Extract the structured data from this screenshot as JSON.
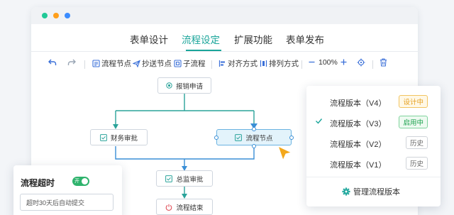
{
  "window": {
    "dots": [
      "#20c997",
      "#ff9f1c",
      "#3b8cff"
    ]
  },
  "tabs": [
    {
      "label": "表单设计",
      "active": false
    },
    {
      "label": "流程设定",
      "active": true
    },
    {
      "label": "扩展功能",
      "active": false
    },
    {
      "label": "表单发布",
      "active": false
    }
  ],
  "toolbar": {
    "undo_icon": "undo-icon",
    "redo_icon": "redo-icon",
    "process_node": "流程节点",
    "cc_node": "抄送节点",
    "sub_process": "子流程",
    "align": "对齐方式",
    "arrange": "排列方式",
    "zoom": "100%",
    "locate_icon": "locate-icon",
    "delete_icon": "trash-icon"
  },
  "flow": {
    "start": "报销申请",
    "finance": "财务审批",
    "process": "流程节点",
    "director": "总监审批",
    "end": "流程结束"
  },
  "versions": {
    "items": [
      {
        "name": "流程版本（V4）",
        "badge": "设计中",
        "status": "design",
        "checked": false
      },
      {
        "name": "流程版本（V3）",
        "badge": "启用中",
        "status": "enable",
        "checked": true
      },
      {
        "name": "流程版本（V2）",
        "badge": "历史",
        "status": "history",
        "checked": false
      },
      {
        "name": "流程版本（V1）",
        "badge": "历史",
        "status": "history",
        "checked": false
      }
    ],
    "manage": "管理流程版本"
  },
  "timeout": {
    "title": "流程超时",
    "toggle": "开",
    "input": "超时30天后自动提交"
  },
  "colors": {
    "accent": "#1aa59a",
    "line": "#2aa39a",
    "connector": "#3a8fd6",
    "cursor": "#f3a81c"
  }
}
